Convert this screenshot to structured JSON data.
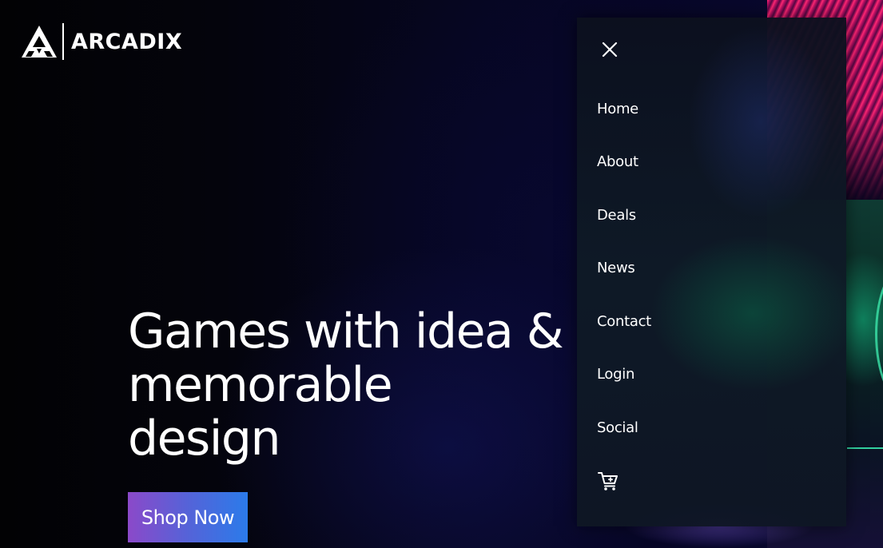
{
  "brand": {
    "name": "ARCADIX",
    "logo_icon": "triangle-logo-icon"
  },
  "hero": {
    "title_lines": [
      "Games with idea &",
      "memorable",
      "design"
    ],
    "cta_label": "Shop Now",
    "cta_gradient": [
      "#8b49c9",
      "#2b7bea"
    ]
  },
  "menu": {
    "close_icon": "close-icon",
    "items": [
      {
        "label": "Home"
      },
      {
        "label": "About"
      },
      {
        "label": "Deals"
      },
      {
        "label": "News"
      },
      {
        "label": "Contact"
      },
      {
        "label": "Login"
      },
      {
        "label": "Social"
      }
    ],
    "cart_icon": "cart-icon"
  }
}
